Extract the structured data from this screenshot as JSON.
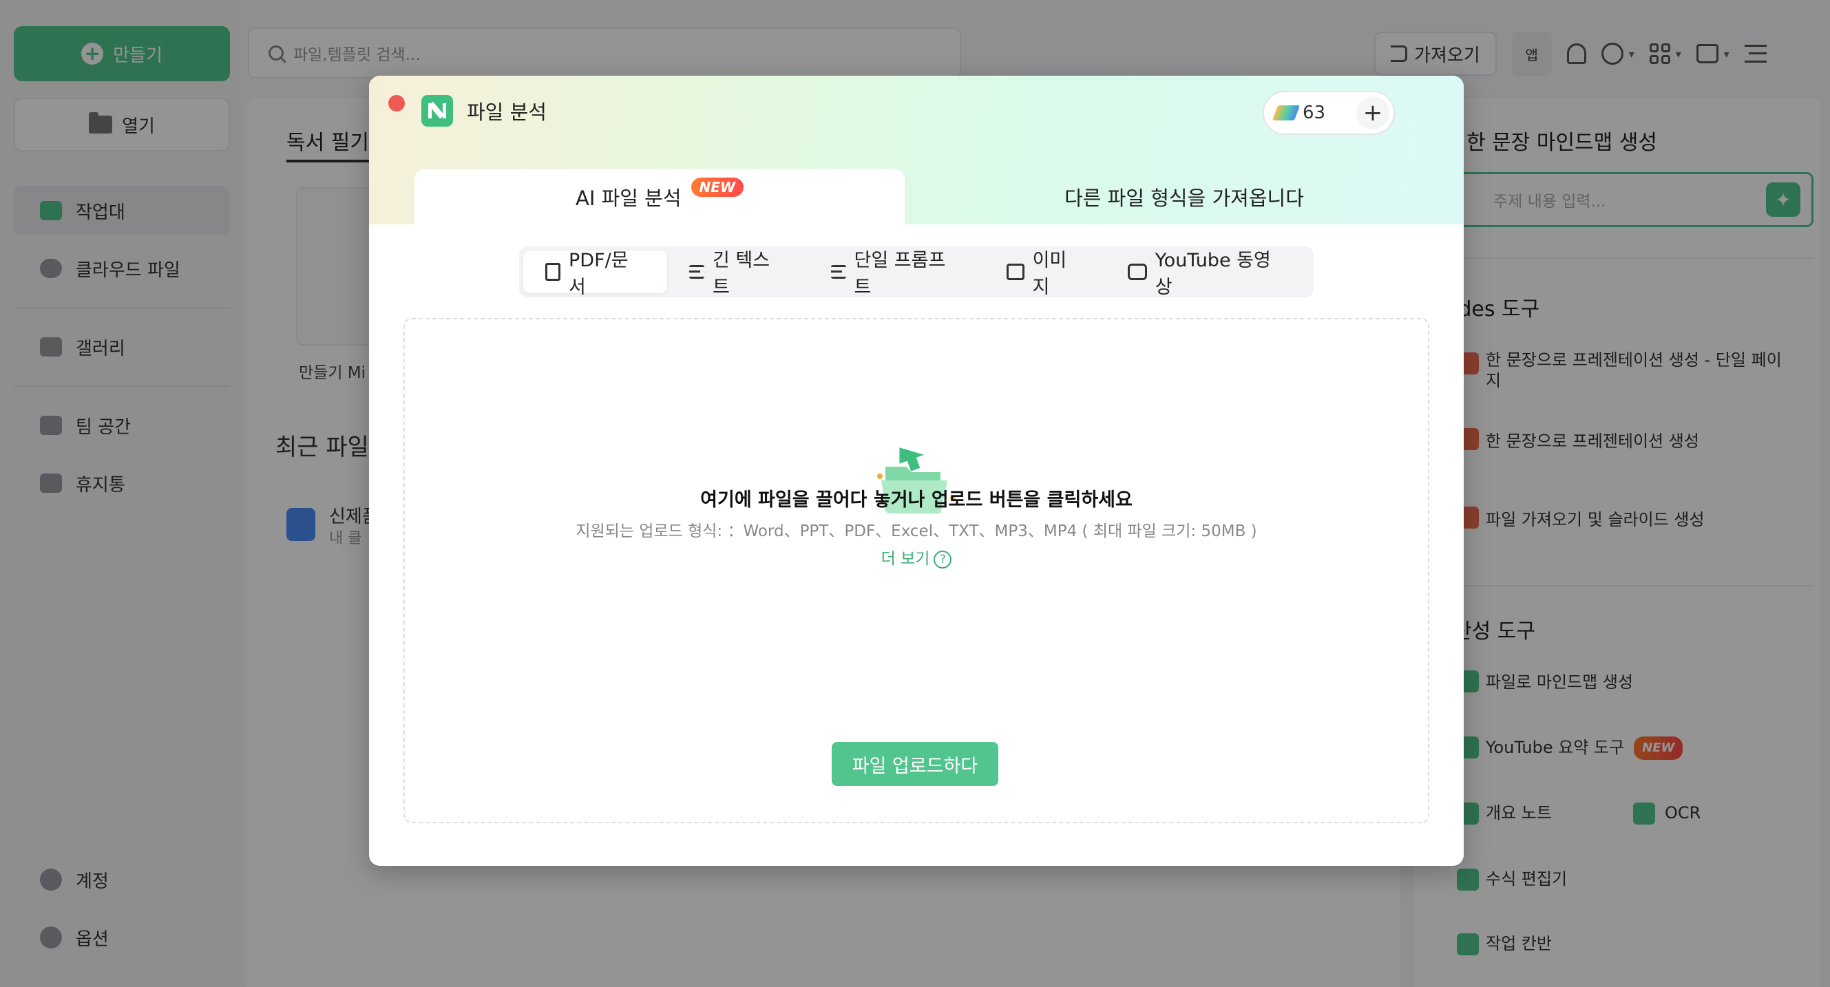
{
  "sidebar": {
    "create_label": "만들기",
    "open_label": "열기",
    "items": [
      {
        "label": "작업대"
      },
      {
        "label": "클라우드 파일"
      },
      {
        "label": "갤러리"
      },
      {
        "label": "팀 공간"
      },
      {
        "label": "휴지통"
      }
    ],
    "account_label": "계정",
    "options_label": "옵션"
  },
  "search": {
    "placeholder": "파일,템플릿 검색..."
  },
  "main": {
    "tab_label": "독서 필기",
    "template_caption": "만들기 Mi",
    "recent_title": "최근 파일",
    "file_name": "신제품",
    "file_sub": "내 클"
  },
  "toolbar": {
    "import_label": "가져오기",
    "app_label": "앱"
  },
  "right_panel": {
    "title": "한 문장 마인드맵 생성",
    "input_placeholder": "주제 내용 입력...",
    "slides_section": "ides 도구",
    "slides_items": [
      "한 문장으로 프레젠테이션 생성 - 단일 페이지",
      "한 문장으로 프레젠테이션 생성",
      "파일 가져오기 및 슬라이드 생성"
    ],
    "productivity_section": "산성 도구",
    "prod_items": [
      "파일로 마인드맵 생성",
      "YouTube 요약 도구",
      "개요 노트",
      "OCR",
      "수식 편집기",
      "작업 칸반"
    ],
    "new_badge": "NEW"
  },
  "modal": {
    "title": "파일 분석",
    "credits": "63",
    "tab_ai": "AI 파일 분석",
    "tab_ai_badge": "NEW",
    "tab_other": "다른 파일 형식을 가져옵니다",
    "subtabs": [
      "PDF/문서",
      "긴 텍스트",
      "단일 프롬프트",
      "이미지",
      "YouTube 동영상"
    ],
    "drop_text": "여기에 파일을 끌어다 놓거나 업로드 버튼을 클릭하세요",
    "supported_text": "지원되는 업로드 형식: ：Word、PPT、PDF、Excel、TXT、MP3、MP4 ( 최대 파일 크기: 50MB )",
    "more_label": "더 보기",
    "upload_label": "파일 업로드하다"
  },
  "colors": {
    "accent": "#52c48d",
    "overlay": "rgba(0,0,0,0.42)",
    "close": "#f05a55"
  }
}
